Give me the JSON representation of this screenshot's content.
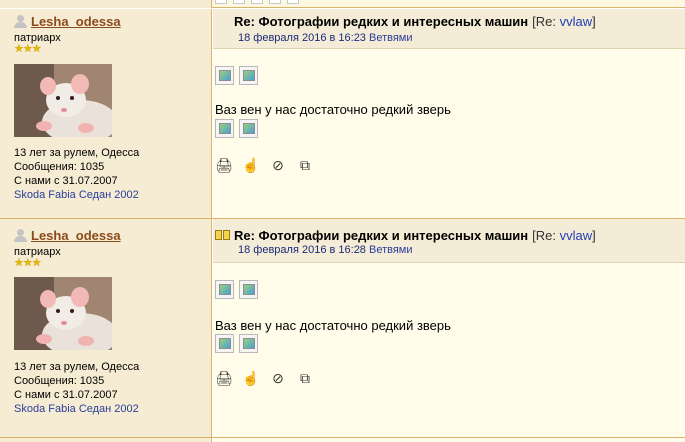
{
  "posts": [
    {
      "author": {
        "name": "Lesha_odessa",
        "rank": "патриарх",
        "stars": "★★★",
        "info": {
          "line1": "13 лет за рулем, Одесса",
          "line2": "Сообщения: 1035",
          "line3": "С нами с 31.07.2007",
          "car": "Skoda Fabia Седан 2002"
        }
      },
      "title": "Re: Фотографии редких и интересных машин",
      "reply_prefix": "[Re: ",
      "reply_user": "vvlaw",
      "reply_suffix": "]",
      "date": "18 февраля 2016 в 16:23",
      "thread_link": "Ветвями",
      "text": "Ваз вен у нас достаточно редкий зверь"
    },
    {
      "author": {
        "name": "Lesha_odessa",
        "rank": "патриарх",
        "stars": "★★★",
        "info": {
          "line1": "13 лет за рулем, Одесса",
          "line2": "Сообщения: 1035",
          "line3": "С нами с 31.07.2007",
          "car": "Skoda Fabia Седан 2002"
        }
      },
      "title": "Re: Фотографии редких и интересных машин",
      "reply_prefix": "[Re: ",
      "reply_user": "vvlaw",
      "reply_suffix": "]",
      "date": "18 февраля 2016 в 16:28",
      "thread_link": "Ветвями",
      "text": "Ваз вен у нас достаточно редкий зверь"
    }
  ],
  "icons": {
    "action_print": "print-icon",
    "action_reply": "hand-reply-icon",
    "action_block": "block-icon",
    "action_quote": "quote-icon"
  },
  "colors": {
    "sidebar_bg": "#f6ecd3",
    "header_bg": "#f4ecd6",
    "body_bg": "#fffde9",
    "border": "#d9b56c",
    "username": "#8a4b1c",
    "link": "#1f3fb4",
    "stars": "#e7b800"
  }
}
